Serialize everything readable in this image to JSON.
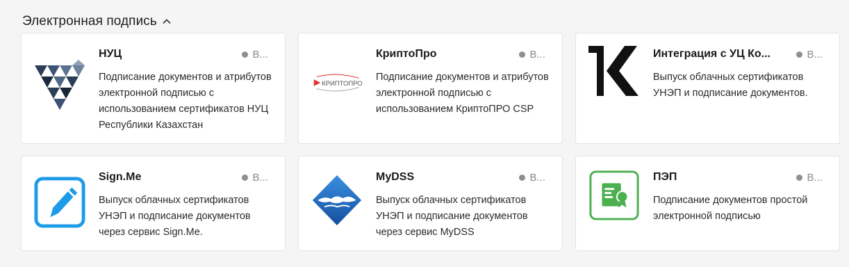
{
  "section": {
    "title": "Электронная подпись"
  },
  "cards": [
    {
      "title": "НУЦ",
      "status": "В...",
      "desc": "Подписание документов и атрибутов электронной подписью с использованием сертификатов НУЦ Республики Казахстан",
      "icon": "nuc-logo-icon"
    },
    {
      "title": "КриптоПро",
      "status": "В...",
      "desc": "Подписание документов и атрибутов электронной подписью с использованием КриптоПРО CSP",
      "icon": "cryptopro-logo-icon",
      "logo_text": "КРИПТОПРО"
    },
    {
      "title": "Интеграция с УЦ Ко...",
      "status": "В...",
      "desc": "Выпуск облачных сертификатов УНЭП и подписание документов.",
      "icon": "k-logo-icon"
    },
    {
      "title": "Sign.Me",
      "status": "В...",
      "desc": "Выпуск облачных сертификатов УНЭП и подписание документов через сервис Sign.Me.",
      "icon": "signme-logo-icon"
    },
    {
      "title": "MyDSS",
      "status": "В...",
      "desc": "Выпуск облачных сертификатов УНЭП и подписание документов через сервис MyDSS",
      "icon": "mydss-logo-icon"
    },
    {
      "title": "ПЭП",
      "status": "В...",
      "desc": "Подписание документов простой электронной подписью",
      "icon": "pep-certificate-icon"
    }
  ],
  "colors": {
    "status_dot": "#8f8f8f",
    "signme_blue": "#1e9be8",
    "pep_green": "#4caf50",
    "mydss_blue": "#1f6fc4",
    "cryptopro_red": "#e2302d"
  }
}
